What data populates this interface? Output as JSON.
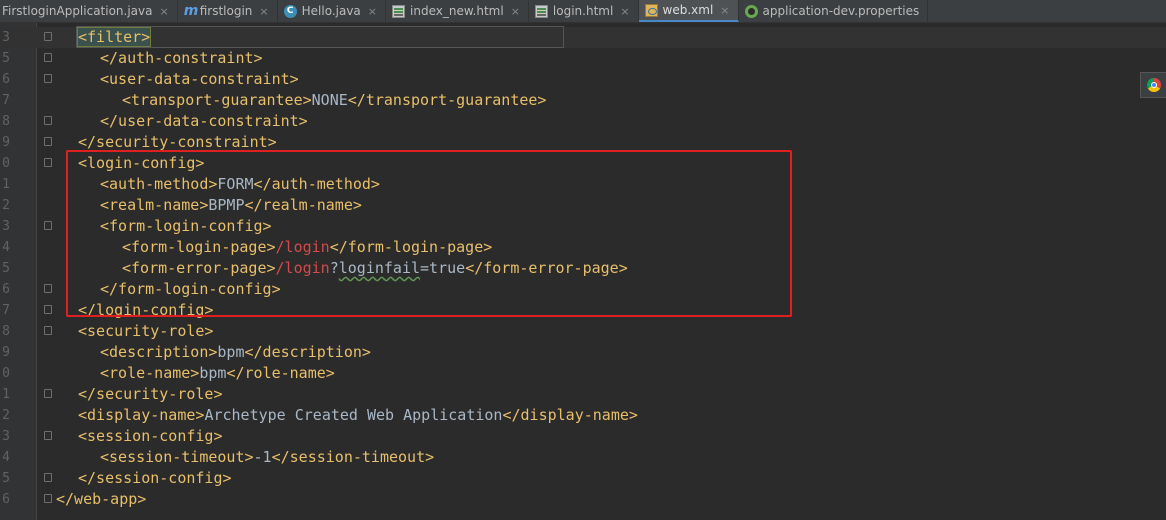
{
  "tabs": [
    {
      "label": "FirstloginApplication.java",
      "icon": "java-class-icon"
    },
    {
      "label": "firstlogin",
      "icon": "maven-module-icon"
    },
    {
      "label": "Hello.java",
      "icon": "java-class-icon"
    },
    {
      "label": "index_new.html",
      "icon": "html-file-icon"
    },
    {
      "label": "login.html",
      "icon": "html-file-icon"
    },
    {
      "label": "web.xml",
      "icon": "xml-file-icon",
      "active": true
    },
    {
      "label": "application-dev.properties",
      "icon": "spring-properties-icon"
    }
  ],
  "close_glyph": "×",
  "gutter": [
    "3",
    "5",
    "6",
    "7",
    "8",
    "9",
    "0",
    "1",
    "2",
    "3",
    "4",
    "5",
    "6",
    "7",
    "8",
    "9",
    "0",
    "1",
    "2",
    "3",
    "4",
    "5",
    "6"
  ],
  "code_lines": [
    [
      {
        "t": "<filter>",
        "c": "tag"
      }
    ],
    [
      {
        "t": "</auth-constraint>",
        "c": "tag"
      }
    ],
    [
      {
        "t": "<user-data-constraint>",
        "c": "tag"
      }
    ],
    [
      {
        "t": "<transport-guarantee>",
        "c": "tag"
      },
      {
        "t": "NONE",
        "c": "txt"
      },
      {
        "t": "</transport-guarantee>",
        "c": "tag"
      }
    ],
    [
      {
        "t": "</user-data-constraint>",
        "c": "tag"
      }
    ],
    [
      {
        "t": "</security-constraint>",
        "c": "tag"
      }
    ],
    [
      {
        "t": "<login-config>",
        "c": "tag"
      }
    ],
    [
      {
        "t": "<auth-method>",
        "c": "tag"
      },
      {
        "t": "FORM",
        "c": "txt"
      },
      {
        "t": "</auth-method>",
        "c": "tag"
      }
    ],
    [
      {
        "t": "<realm-name>",
        "c": "tag"
      },
      {
        "t": "BPMP",
        "c": "txt"
      },
      {
        "t": "</realm-name>",
        "c": "tag"
      }
    ],
    [
      {
        "t": "<form-login-config>",
        "c": "tag"
      }
    ],
    [
      {
        "t": "<form-login-page>",
        "c": "tag"
      },
      {
        "t": "/login",
        "c": "url"
      },
      {
        "t": "</form-login-page>",
        "c": "tag"
      }
    ],
    [
      {
        "t": "<form-error-page>",
        "c": "tag"
      },
      {
        "t": "/login",
        "c": "url"
      },
      {
        "t": "?",
        "c": "txt"
      },
      {
        "t": "loginfail",
        "c": "txt wavy"
      },
      {
        "t": "=true",
        "c": "txt"
      },
      {
        "t": "</form-error-page>",
        "c": "tag"
      }
    ],
    [
      {
        "t": "</form-login-config>",
        "c": "tag"
      }
    ],
    [
      {
        "t": "</login-config>",
        "c": "tag"
      }
    ],
    [
      {
        "t": "<security-role>",
        "c": "tag"
      }
    ],
    [
      {
        "t": "<description>",
        "c": "tag"
      },
      {
        "t": "bpm",
        "c": "txt"
      },
      {
        "t": "</description>",
        "c": "tag"
      }
    ],
    [
      {
        "t": "<role-name>",
        "c": "tag"
      },
      {
        "t": "bpm",
        "c": "txt"
      },
      {
        "t": "</role-name>",
        "c": "tag"
      }
    ],
    [
      {
        "t": "</security-role>",
        "c": "tag"
      }
    ],
    [
      {
        "t": "<display-name>",
        "c": "tag"
      },
      {
        "t": "Archetype Created Web Application",
        "c": "txt"
      },
      {
        "t": "</display-name>",
        "c": "tag"
      }
    ],
    [
      {
        "t": "<session-config>",
        "c": "tag"
      }
    ],
    [
      {
        "t": "<session-timeout>",
        "c": "tag"
      },
      {
        "t": "-1",
        "c": "txt"
      },
      {
        "t": "</session-timeout>",
        "c": "tag"
      }
    ],
    [
      {
        "t": "</session-config>",
        "c": "tag"
      }
    ],
    [
      {
        "t": "</web-app>",
        "c": "tag"
      }
    ]
  ],
  "colors": {
    "tag": "#e8bf6a",
    "text": "#a9b7c6",
    "url": "#d44a4a",
    "highlight": "#e02020",
    "background": "#2b2b2b"
  }
}
